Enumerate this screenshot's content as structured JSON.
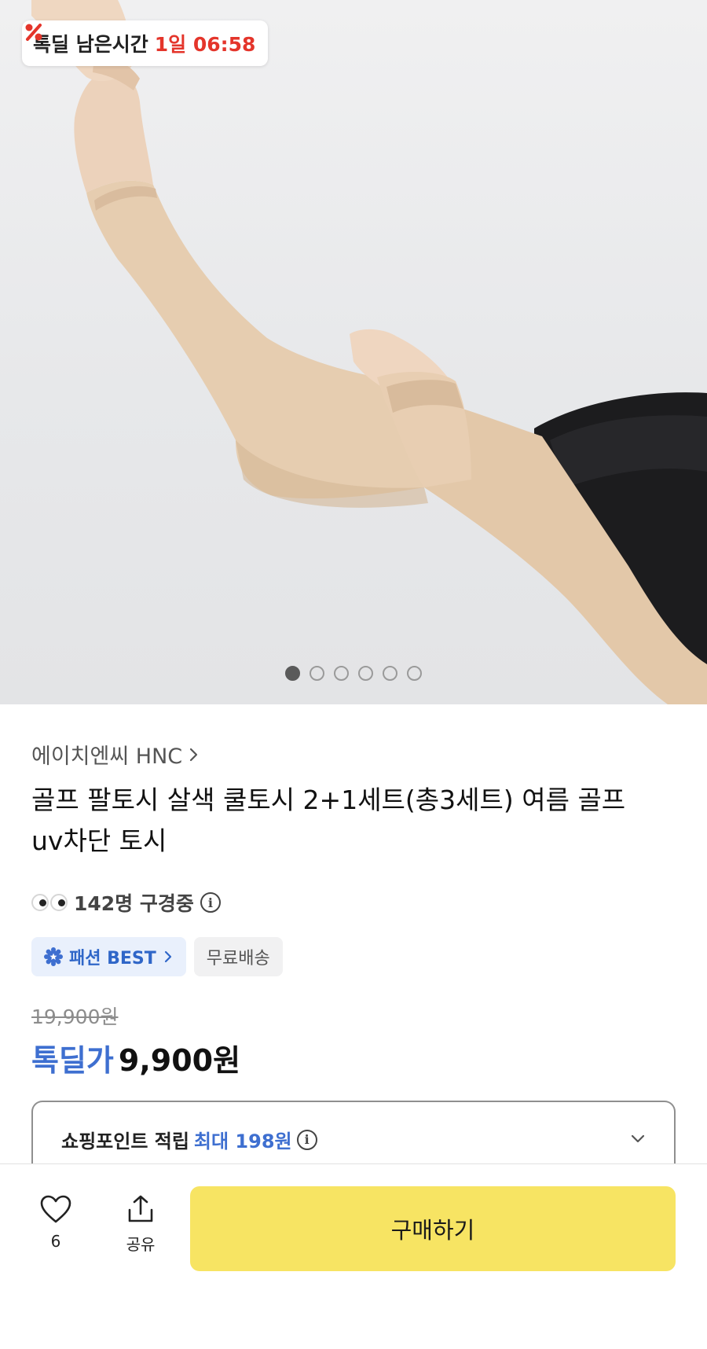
{
  "deal_timer": {
    "label": "톡딜 남은시간",
    "time": "1일 06:58",
    "icon": "percent-icon",
    "color": "#e4352b"
  },
  "carousel": {
    "total": 6,
    "active_index": 0
  },
  "product": {
    "brand": "에이치엔씨 HNC",
    "title": "골프 팔토시 살색 쿨토시 2+1세트(총3세트) 여름 골프 uv차단 토시",
    "viewers": "142명 구경중",
    "badges": {
      "best": "패션 BEST",
      "shipping": "무료배송"
    },
    "original_price": "19,900원",
    "deal_label": "톡딜가",
    "deal_price": "9,900원"
  },
  "points": {
    "label": "쇼핑포인트 적립",
    "max": "최대 198원"
  },
  "bottom_bar": {
    "like_count": "6",
    "share_label": "공유",
    "buy_label": "구매하기"
  },
  "colors": {
    "accent_blue": "#3e6fd0",
    "buy_yellow": "#f7e463",
    "timer_red": "#e4352b"
  }
}
